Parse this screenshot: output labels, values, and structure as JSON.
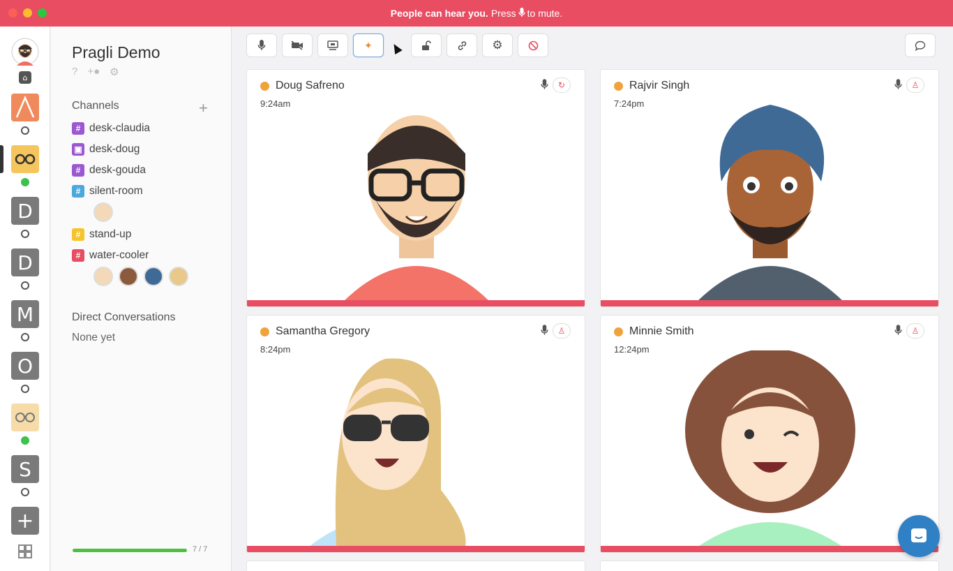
{
  "banner": {
    "bold": "People can hear you.",
    "rest_a": "Press",
    "rest_b": "to mute."
  },
  "org": {
    "name": "Pragli Demo"
  },
  "channels_heading": "Channels",
  "channels": [
    {
      "name": "desk-claudia",
      "color": "#9b59d0",
      "icon": "hash"
    },
    {
      "name": "desk-doug",
      "color": "#9b59d0",
      "icon": "lock"
    },
    {
      "name": "desk-gouda",
      "color": "#9b59d0",
      "icon": "hash"
    },
    {
      "name": "silent-room",
      "color": "#4aa8de",
      "icon": "hash"
    },
    {
      "name": "stand-up",
      "color": "#f5c32a",
      "icon": "hash"
    },
    {
      "name": "water-cooler",
      "color": "#e84d62",
      "icon": "hash"
    }
  ],
  "direct_heading": "Direct Conversations",
  "direct_empty": "None yet",
  "rail_letters": [
    "D",
    "D",
    "M",
    "O",
    "S"
  ],
  "progress": {
    "label": "7 / 7",
    "fraction": 1.0
  },
  "tiles": [
    {
      "name": "Doug Safreno",
      "time": "9:24am"
    },
    {
      "name": "Rajvir Singh",
      "time": "7:24pm"
    },
    {
      "name": "Samantha Gregory",
      "time": "8:24pm"
    },
    {
      "name": "Minnie Smith",
      "time": "12:24pm"
    }
  ],
  "toolbar_icons": [
    "mic-icon",
    "video-off-icon",
    "screen-share-icon",
    "party-icon",
    "unlock-icon",
    "link-icon",
    "settings-icon",
    "block-icon"
  ],
  "colors": {
    "accent": "#e84d62",
    "online": "#3dc24d",
    "away": "#f0a33c"
  }
}
